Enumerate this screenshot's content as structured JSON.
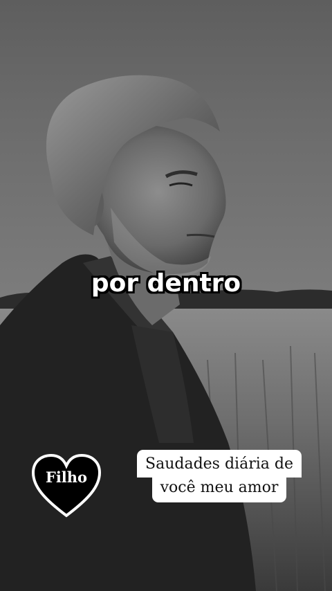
{
  "caption": {
    "text": "por dentro"
  },
  "badge": {
    "label": "Filho",
    "icon": "heart-icon"
  },
  "message": {
    "line1": "Saudades diária de",
    "line2": "você meu amor"
  }
}
